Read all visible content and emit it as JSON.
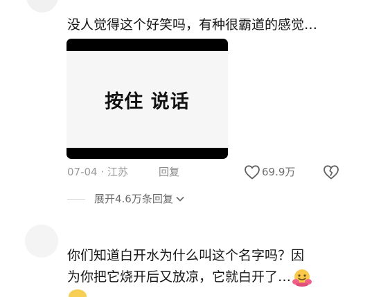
{
  "comment1": {
    "text": "没人觉得这个好笑吗，有种很霸道的感觉…",
    "image_text": "按住 说话",
    "date": "07-04",
    "location": "江苏",
    "reply_label": "回复",
    "like_count": "69.9万",
    "expand_replies": "展开4.6万条回复"
  },
  "comment2": {
    "line1": "你们知道白开水为什么叫这个名字吗？因",
    "line2": "为你把它烧开后又放凉，它就白开了…"
  },
  "icons": {
    "like": "heart-outline-icon",
    "dislike": "broken-heart-icon",
    "expand": "chevron-down-icon",
    "emoji": "hugging-face-emoji"
  },
  "colors": {
    "text": "#161616",
    "meta": "#9a9a9a",
    "image_bar": "#000000",
    "image_bg": "#f6f6f6"
  }
}
